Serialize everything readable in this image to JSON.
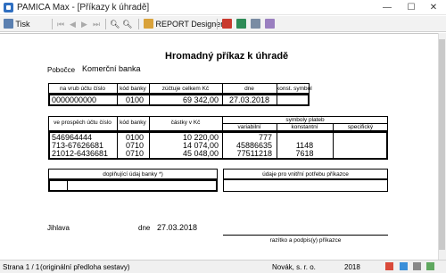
{
  "window": {
    "title": "PAMICA Max - [Příkazy k úhradě]",
    "controls": {
      "minimize": "—",
      "maximize": "☐",
      "close": "✕"
    }
  },
  "toolbar": {
    "print_label": "Tisk",
    "report_designer_label": "REPORT Designer",
    "icons": [
      "print-icon",
      "first-page-icon",
      "prev-page-icon",
      "next-page-icon",
      "last-page-icon",
      "zoom-icon",
      "zoom-out-icon",
      "report-designer-icon",
      "pdf-icon",
      "export-icon",
      "mail-icon",
      "settings-icon"
    ]
  },
  "document": {
    "title": "Hromadný příkaz k úhradě",
    "branch_label": "Pobočce",
    "branch_value": "Komerční banka",
    "debit": {
      "headers": [
        "na vrub účtu číslo",
        "kód banky",
        "zúčtuje celkem Kč",
        "dne",
        "konst. symbol"
      ],
      "values": [
        "0000000000",
        "0100",
        "69 342,00",
        "27.03.2018",
        ""
      ]
    },
    "credit": {
      "headers": [
        "ve prospěch účtu číslo",
        "kód banky",
        "částky v Kč"
      ],
      "symbols_header": "symboly plateb",
      "symbols_subheaders": [
        "variabilní",
        "konstantní",
        "specifický"
      ],
      "rows": [
        {
          "account": "546964444",
          "bank": "0100",
          "amount": "10 220,00",
          "variable": "777",
          "constant": "",
          "specific": ""
        },
        {
          "account": "713-67626681",
          "bank": "0710",
          "amount": "14 074,00",
          "variable": "45886635",
          "constant": "1148",
          "specific": ""
        },
        {
          "account": "21012-6436681",
          "bank": "0710",
          "amount": "45 048,00",
          "variable": "77511218",
          "constant": "7618",
          "specific": ""
        }
      ]
    },
    "additional_bank_label": "doplňující údaj banky *)",
    "internal_label": "údaje pro vnitřní potřebu příkazce",
    "place": "Jihlava",
    "date_label": "dne",
    "date_value": "27.03.2018",
    "stamp_label": "razítko a podpis(y) příkazce"
  },
  "status": {
    "page": "Strana 1 / 1",
    "template": "(originální předloha sestavy)",
    "company": "Novák, s. r. o.",
    "year": "2018"
  },
  "colors": {
    "accent": "#2f6fc1",
    "toolbar_bg": "#f2f2f2",
    "statusbar_bg": "#f0f0f0"
  }
}
